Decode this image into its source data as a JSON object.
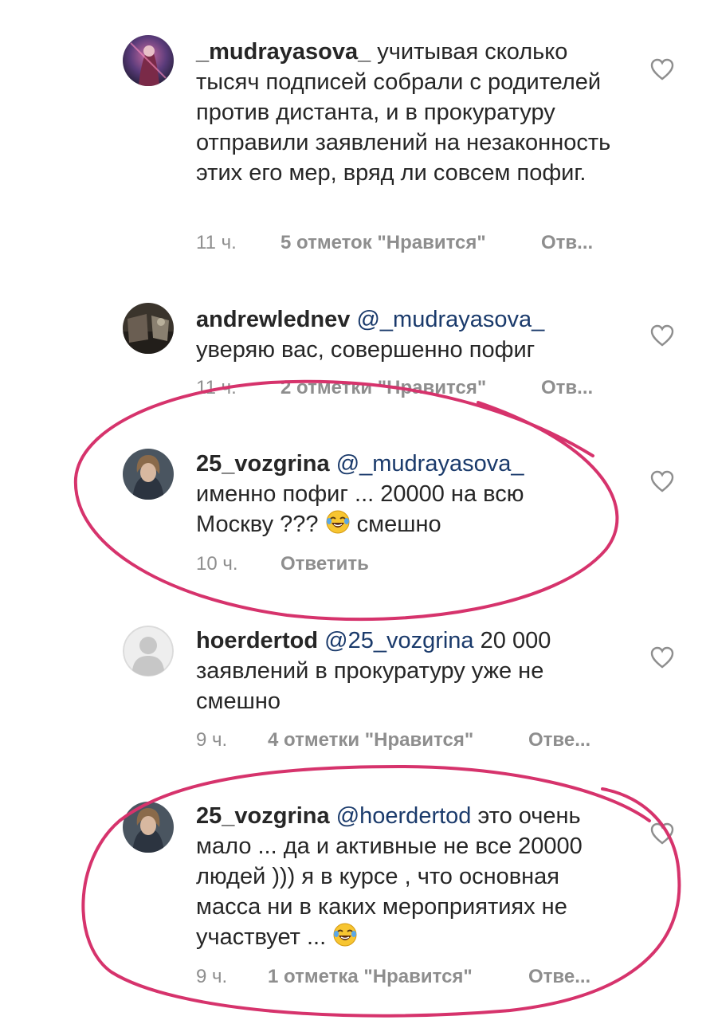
{
  "comments": [
    {
      "username": "_mudrayasova_",
      "mention": "",
      "text": " учитывая сколько тысяч подписей собрали с родителей против дистанта, и в прокуратуру отправили заявлений на незаконность этих его мер, вряд ли совсем пофиг.",
      "time": "11 ч.",
      "likes": "5 отметок \"Нравится\"",
      "reply": "Отв..."
    },
    {
      "username": "andrewlednev",
      "mention": "@_mudrayasova_",
      "text": "уверяю вас, совершенно пофиг",
      "time": "11 ч.",
      "likes": "2 отметки \"Нравится\"",
      "reply": "Отв..."
    },
    {
      "username": "25_vozgrina",
      "mention": "@_mudrayasova_",
      "text1": "именно пофиг ... 20000 на всю",
      "text2": "Москву ??? ",
      "text3": " смешно",
      "time": "10 ч.",
      "likes": "",
      "reply": "Ответить"
    },
    {
      "username": "hoerdertod",
      "mention": "@25_vozgrina",
      "text": " 20 000 заявлений в прокуратуру уже не смешно",
      "time": "9 ч.",
      "likes": "4 отметки \"Нравится\"",
      "reply": "Отве..."
    },
    {
      "username": "25_vozgrina",
      "mention": "@hoerdertod",
      "text": " это очень мало ... да и активные не все 20000 людей ))) я в курсе , что основная масса ни в каких мероприятиях не участвует ... ",
      "time": "9 ч.",
      "likes": "1 отметка \"Нравится\"",
      "reply": "Отве..."
    }
  ],
  "icons": {
    "like": "heart-outline-icon",
    "emoji": "face-with-tears-of-joy-emoji"
  },
  "colors": {
    "text": "#262626",
    "meta": "#8e8e8e",
    "mention": "#1a3a6b",
    "annotation": "#d6336c"
  }
}
